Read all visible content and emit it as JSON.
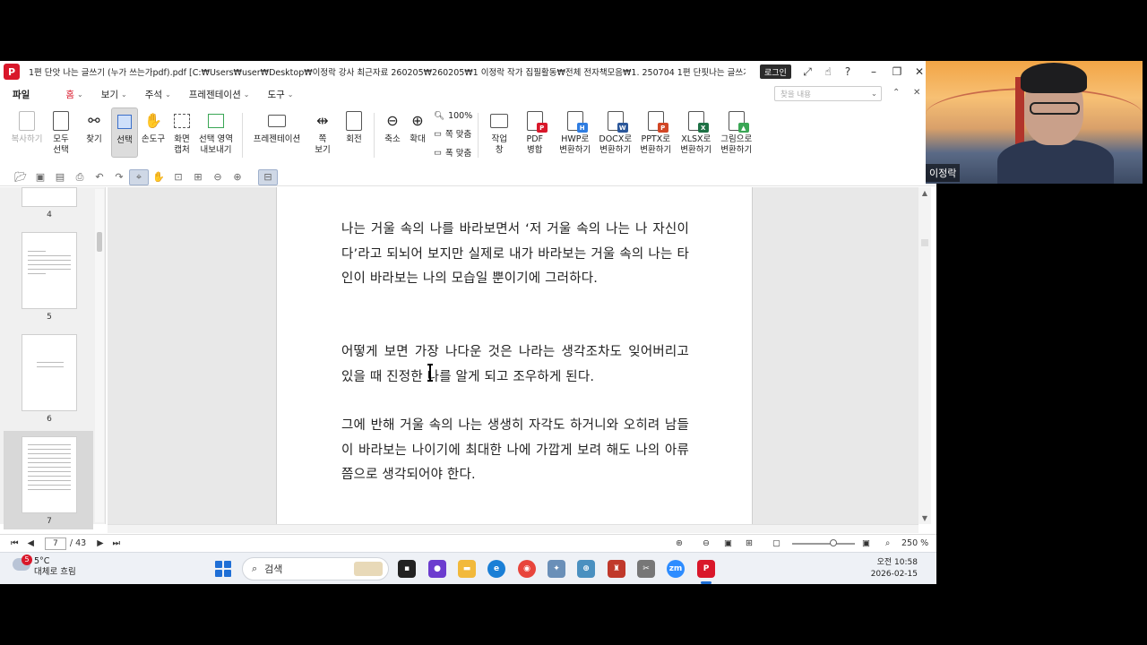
{
  "window": {
    "title": "1편 단앗 나는 글쓰기 (누가 쓰는가pdf).pdf [C:₩Users₩user₩Desktop₩이정락 강사 최근자료 260205₩260205₩1 이정락 작가 집필활동₩전체 전자책모음₩1. 250704 1편 단핏나는 글쓰기 (누가 쓰...",
    "login_label": "로그인",
    "logo_letter": "P"
  },
  "menu": {
    "file": "파일",
    "items": [
      "홈",
      "보기",
      "주석",
      "프레젠테이션",
      "도구"
    ],
    "search_placeholder": "찾을 내용"
  },
  "ribbon": {
    "buttons": [
      {
        "label": "복사하기",
        "icon": "copy-icon"
      },
      {
        "label": "모두\n선택",
        "icon": "select-all-icon"
      },
      {
        "label": "찾기",
        "icon": "binoculars-icon"
      },
      {
        "label": "선택",
        "icon": "select-cursor-icon"
      },
      {
        "label": "손도구",
        "icon": "hand-icon"
      },
      {
        "label": "화면\n캡처",
        "icon": "screen-capture-icon"
      },
      {
        "label": "선택 영역\n내보내기",
        "icon": "export-area-icon"
      },
      {
        "label": "프레젠테이션",
        "icon": "presentation-icon"
      },
      {
        "label": "쪽\n보기",
        "icon": "page-view-icon"
      },
      {
        "label": "회전",
        "icon": "rotate-icon"
      },
      {
        "label": "축소",
        "icon": "zoom-out-icon"
      },
      {
        "label": "확대",
        "icon": "zoom-in-icon"
      }
    ],
    "zoom_group": {
      "zoom": "100%",
      "fit_page": "쪽 맞춤",
      "fit_width": "폭 맞춤"
    },
    "convert": [
      {
        "label": "작업\n창",
        "icon": "task-pane-icon"
      },
      {
        "label": "PDF\n병합",
        "icon": "pdf-merge-icon",
        "color": "#d9172a",
        "badge": "P"
      },
      {
        "label": "HWP로\n변환하기",
        "icon": "hwp-convert-icon",
        "color": "#2f7de1",
        "badge": "H"
      },
      {
        "label": "DOCX로\n변환하기",
        "icon": "docx-convert-icon",
        "color": "#2b579a",
        "badge": "W"
      },
      {
        "label": "PPTX로\n변환하기",
        "icon": "pptx-convert-icon",
        "color": "#d24726",
        "badge": "P"
      },
      {
        "label": "XLSX로\n변환하기",
        "icon": "xlsx-convert-icon",
        "color": "#1e7145",
        "badge": "X"
      },
      {
        "label": "그림으로\n변환하기",
        "icon": "image-convert-icon",
        "color": "#3aa655",
        "badge": "▲"
      }
    ]
  },
  "thumbnails": [
    {
      "page": "4"
    },
    {
      "page": "5"
    },
    {
      "page": "6"
    },
    {
      "page": "7",
      "selected": true
    }
  ],
  "document": {
    "paragraphs": [
      "나는 거울 속의 나를 바라보면서 ‘저 거울 속의 나는 나 자신이다’라고 되뇌어 보지만 실제로 내가 바라보는 거울 속의 나는 타인이 바라보는 나의 모습일 뿐이기에 그러하다.",
      "어떻게 보면 가장 나다운 것은 나라는 생각조차도 잊어버리고 있을 때 진정한 나를 알게 되고 조우하게 된다.",
      "그에 반해 거울 속의 나는 생생히 자각도 하거니와 오히려 남들이 바라보는 나이기에 최대한 나에 가깝게 보려 해도 나의 아류쯤으로 생각되어야 한다."
    ]
  },
  "status": {
    "current_page": "7",
    "total_pages": "/ 43",
    "zoom": "250 %"
  },
  "taskbar": {
    "temperature": "5°C",
    "weather": "대체로 흐림",
    "alert_count": "5",
    "search_label": "검색",
    "time": "오전 10:58",
    "date": "2026-02-15"
  },
  "webcam": {
    "name": "이정락"
  }
}
